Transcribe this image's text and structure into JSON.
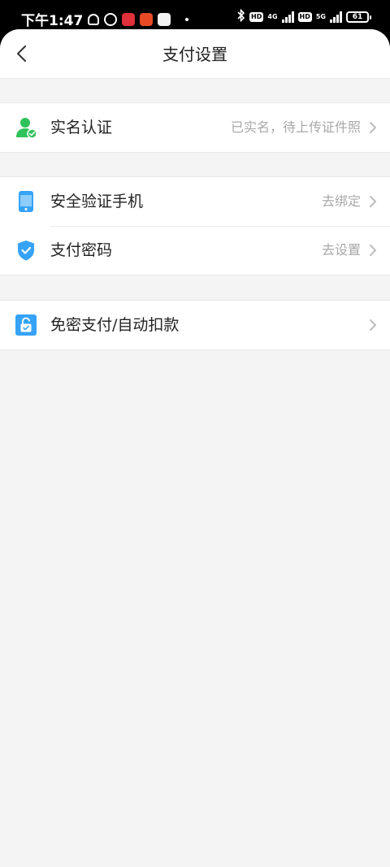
{
  "status_bar": {
    "time": "下午1:47",
    "battery": "61",
    "network_1": "4G",
    "network_2": "5G",
    "hd_label": "HD"
  },
  "nav": {
    "title": "支付设置"
  },
  "groups": [
    {
      "items": [
        {
          "label": "实名认证",
          "value": "已实名，待上传证件照",
          "icon": "user-verified-icon"
        }
      ]
    },
    {
      "items": [
        {
          "label": "安全验证手机",
          "value": "去绑定",
          "icon": "phone-icon"
        },
        {
          "label": "支付密码",
          "value": "去设置",
          "icon": "shield-icon"
        }
      ]
    },
    {
      "items": [
        {
          "label": "免密支付/自动扣款",
          "value": "",
          "icon": "lock-icon"
        }
      ]
    }
  ],
  "colors": {
    "background": "#f4f4f4",
    "green": "#2fc25b",
    "blue": "#36a3f7",
    "chevron": "#bdbdbd"
  }
}
